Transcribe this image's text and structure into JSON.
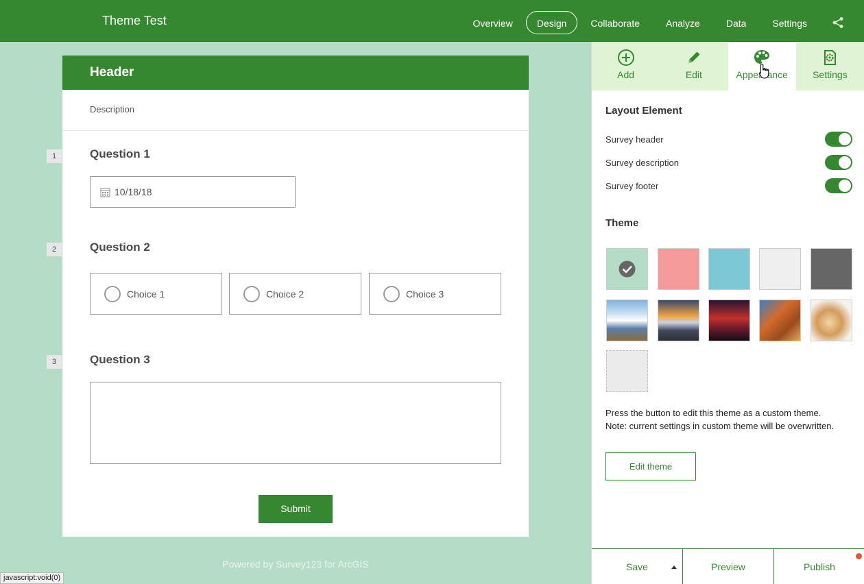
{
  "app": {
    "title": "Theme Test"
  },
  "topnav": {
    "items": [
      "Overview",
      "Design",
      "Collaborate",
      "Analyze",
      "Data",
      "Settings"
    ],
    "active": "Design",
    "share_icon": "share-icon"
  },
  "form": {
    "header": "Header",
    "description": "Description",
    "questions": [
      {
        "number": "1",
        "title": "Question 1",
        "date_value": "10/18/18"
      },
      {
        "number": "2",
        "title": "Question 2",
        "choices": [
          "Choice 1",
          "Choice 2",
          "Choice 3"
        ]
      },
      {
        "number": "3",
        "title": "Question 3"
      }
    ],
    "submit_label": "Submit",
    "powered_by": "Powered by Survey123 for ArcGIS"
  },
  "status_bar": "javascript:void(0)",
  "panel": {
    "tabs": [
      {
        "label": "Add",
        "icon": "plus-circle-icon"
      },
      {
        "label": "Edit",
        "icon": "pencil-icon"
      },
      {
        "label": "Appearance",
        "icon": "palette-icon"
      },
      {
        "label": "Settings",
        "icon": "settings-gear-icon"
      }
    ],
    "active_tab": "Appearance",
    "layout_title": "Layout Element",
    "toggles": [
      {
        "label": "Survey header",
        "on": true
      },
      {
        "label": "Survey description",
        "on": true
      },
      {
        "label": "Survey footer",
        "on": true
      }
    ],
    "theme_title": "Theme",
    "theme_swatches": [
      "#b5dcc6",
      "#f49a9b",
      "#7cc8d4",
      "#efefef",
      "#666666"
    ],
    "selected_theme": 0,
    "note_line1": "Press the button to edit this theme as a custom theme.",
    "note_line2": "Note: current settings in custom theme will be overwritten.",
    "edit_theme_label": "Edit theme",
    "footer": {
      "save": "Save",
      "preview": "Preview",
      "publish": "Publish"
    }
  },
  "colors": {
    "brand": "#35882f",
    "background": "#b5dcc6",
    "tab_bg": "#dff4d4",
    "notify": "#e0543a"
  }
}
